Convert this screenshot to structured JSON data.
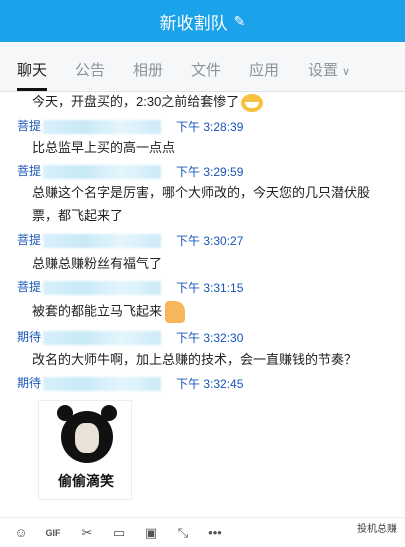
{
  "window": {
    "title": "新收割队"
  },
  "tabs": [
    {
      "label": "聊天",
      "active": true
    },
    {
      "label": "公告"
    },
    {
      "label": "相册"
    },
    {
      "label": "文件"
    },
    {
      "label": "应用"
    },
    {
      "label": "设置"
    }
  ],
  "messages": [
    {
      "text": "今天，开盘买的，2:30之前给套惨了"
    },
    {
      "sender": "菩提",
      "time": "下午 3:28:39",
      "text": "比总监早上买的高一点点"
    },
    {
      "sender": "菩提",
      "time": "下午 3:29:59",
      "text": "总赚这个名字是厉害，哪个大师改的，今天您的几只潜伏股",
      "text2": "票，都飞起来了"
    },
    {
      "sender": "菩提",
      "time": "下午 3:30:27",
      "text": "总赚总赚粉丝有福气了"
    },
    {
      "sender": "菩提",
      "time": "下午 3:31:15",
      "text": "被套的都能立马飞起来"
    },
    {
      "sender": "期待",
      "time": "下午 3:32:30",
      "text": "改名的大师牛啊，加上总赚的技术，会一直赚钱的节奏？"
    },
    {
      "sender": "期待",
      "time": "下午 3:32:45"
    }
  ],
  "sticker": {
    "caption": "偷偷滴笑"
  },
  "watermark": "投机总赚",
  "colors": {
    "accent": "#1aa3eb",
    "sender": "#1a55b8"
  }
}
